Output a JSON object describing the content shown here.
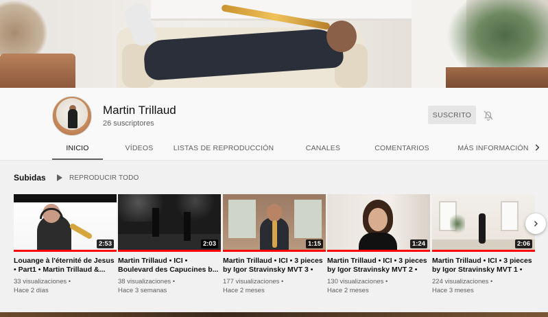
{
  "channel": {
    "name": "Martin Trillaud",
    "subscribers": "26 suscriptores",
    "subscribe_label": "SUSCRITO"
  },
  "tabs": [
    {
      "label": "INICIO",
      "active": true
    },
    {
      "label": "VÍDEOS"
    },
    {
      "label": "LISTAS DE REPRODUCCIÓN"
    },
    {
      "label": "CANALES"
    },
    {
      "label": "COMENTARIOS"
    },
    {
      "label": "MÁS INFORMACIÓN"
    }
  ],
  "shelf": {
    "title": "Subidas",
    "play_all": "REPRODUCIR TODO"
  },
  "videos": [
    {
      "title": "Louange à l'éternité de Jesus • Part1 • Martin Trillaud &...",
      "views": "33 visualizaciones •",
      "age": "Hace 2 días",
      "duration": "2:53",
      "watched": 1.0
    },
    {
      "title": "Martin Trillaud • ICI • Boulevard des Capucines b...",
      "views": "38 visualizaciones •",
      "age": "Hace 3 semanas",
      "duration": "2:03",
      "watched": 1.0
    },
    {
      "title": "Martin Trillaud • ICI • 3 pieces by Igor Stravinsky MVT 3 •",
      "views": "177 visualizaciones •",
      "age": "Hace 2 meses",
      "duration": "1:15",
      "watched": 1.0
    },
    {
      "title": "Martin Trillaud • ICI • 3 pieces by Igor Stravinsky MVT 2 •",
      "views": "130 visualizaciones •",
      "age": "Hace 2 meses",
      "duration": "1:24",
      "watched": 1.0
    },
    {
      "title": "Martin Trillaud • ICI • 3 pieces by Igor Stravinsky MVT 1 •",
      "views": "224 visualizaciones •",
      "age": "Hace 3 meses",
      "duration": "2:06",
      "watched": 1.0
    }
  ],
  "colors": {
    "progress": "#ff0000",
    "background": "#f9f9f9",
    "shelf_background": "#f1f1f1"
  },
  "icons": {
    "bell": "bell-off-icon",
    "play": "play-icon",
    "tabs_next": "chevron-right-icon",
    "shelf_next": "chevron-right-icon"
  }
}
